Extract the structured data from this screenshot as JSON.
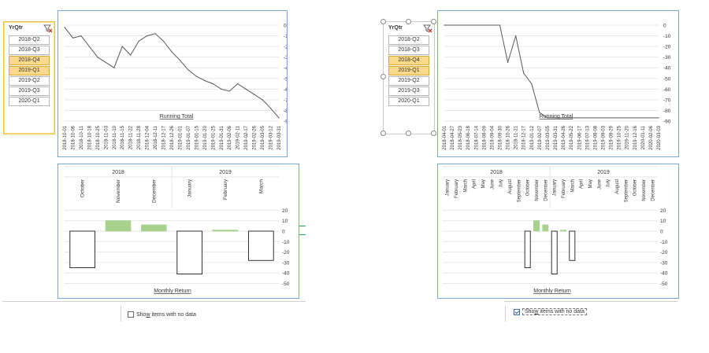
{
  "left": {
    "slicer": {
      "title": "YrQtr",
      "filter_icon": "clear-filter-icon",
      "items": [
        {
          "label": "2018-Q2",
          "selected": false
        },
        {
          "label": "2018-Q3",
          "selected": false
        },
        {
          "label": "2018-Q4",
          "selected": true
        },
        {
          "label": "2019-Q1",
          "selected": true
        },
        {
          "label": "2019-Q2",
          "selected": false
        },
        {
          "label": "2019-Q3",
          "selected": false
        },
        {
          "label": "2020-Q1",
          "selected": false
        }
      ]
    },
    "running_chart": {
      "title": "Running Total",
      "x_labels": [
        "2018-10-01",
        "2018-10-06",
        "2018-10-11",
        "2018-10-18",
        "2018-10-25",
        "2018-11-03",
        "2018-11-10",
        "2018-11-15",
        "2018-11-22",
        "2018-11-28",
        "2018-12-04",
        "2018-12-11",
        "2018-12-17",
        "2018-12-26",
        "2019-01-01",
        "2019-01-07",
        "2019-01-15",
        "2019-01-20",
        "2019-01-25",
        "2019-01-31",
        "2019-02-06",
        "2019-02-11",
        "2019-02-17",
        "2019-02-26",
        "2019-03-05",
        "2019-03-12",
        "2019-03-31"
      ],
      "y_ticks": [
        "0",
        "-10",
        "-20",
        "-30",
        "-40",
        "-50",
        "-60",
        "-70",
        "-80",
        "-90"
      ]
    },
    "monthly_chart": {
      "title": "Monthly Return",
      "years": [
        "2018",
        "2019"
      ],
      "months": [
        "October",
        "November",
        "December",
        "January",
        "February",
        "March"
      ],
      "y_ticks": [
        "20",
        "10",
        "0",
        "-10",
        "-20",
        "-30",
        "-40",
        "-50"
      ]
    },
    "show_items_label_pre": "Sho",
    "show_items_label_ul": "w",
    "show_items_label_post": " items with no data"
  },
  "right": {
    "slicer": {
      "title": "YrQtr",
      "filter_icon": "clear-filter-icon",
      "items": [
        {
          "label": "2018-Q2",
          "selected": false
        },
        {
          "label": "2018-Q3",
          "selected": false
        },
        {
          "label": "2018-Q4",
          "selected": true
        },
        {
          "label": "2019-Q1",
          "selected": true
        },
        {
          "label": "2019-Q2",
          "selected": false
        },
        {
          "label": "2019-Q3",
          "selected": false
        },
        {
          "label": "2020-Q1",
          "selected": false
        }
      ]
    },
    "running_chart": {
      "title": "Running Total",
      "x_labels": [
        "2018-04-01",
        "2018-04-27",
        "2018-05-23",
        "2018-06-18",
        "2018-07-14",
        "2018-08-09",
        "2018-09-04",
        "2018-09-30",
        "2018-10-26",
        "2018-11-21",
        "2018-12-17",
        "2019-01-12",
        "2019-02-07",
        "2019-03-05",
        "2019-03-31",
        "2019-04-26",
        "2019-05-22",
        "2019-06-17",
        "2019-07-13",
        "2019-08-08",
        "2019-09-03",
        "2019-09-29",
        "2019-10-25",
        "2019-11-20",
        "2019-12-16",
        "2020-01-11",
        "2020-02-06",
        "2020-03-03"
      ],
      "y_ticks": [
        "0",
        "-10",
        "-20",
        "-30",
        "-40",
        "-50",
        "-60",
        "-70",
        "-80",
        "-90"
      ]
    },
    "monthly_chart": {
      "title": "Monthly Return",
      "years": [
        "2018",
        "2019"
      ],
      "months_2018": [
        "January",
        "February",
        "March",
        "April",
        "May",
        "June",
        "July",
        "August",
        "September",
        "October",
        "November",
        "December"
      ],
      "months_2019": [
        "January",
        "February",
        "March",
        "April",
        "May",
        "June",
        "July",
        "August",
        "September",
        "October",
        "November",
        "December"
      ],
      "y_ticks": [
        "20",
        "10",
        "0",
        "-10",
        "-20",
        "-30",
        "-40",
        "-50"
      ]
    },
    "show_items_label_pre": "Sho",
    "show_items_label_ul": "w",
    "show_items_label_post": " items with no data"
  },
  "chart_data": [
    {
      "type": "line",
      "title": "Running Total",
      "ylim": [
        -90,
        0
      ],
      "x": [
        "2018-10-01",
        "2018-10-06",
        "2018-10-11",
        "2018-10-18",
        "2018-10-25",
        "2018-11-03",
        "2018-11-10",
        "2018-11-15",
        "2018-11-22",
        "2018-11-28",
        "2018-12-04",
        "2018-12-11",
        "2018-12-17",
        "2018-12-26",
        "2019-01-01",
        "2019-01-07",
        "2019-01-15",
        "2019-01-20",
        "2019-01-25",
        "2019-01-31",
        "2019-02-06",
        "2019-02-11",
        "2019-02-17",
        "2019-02-26",
        "2019-03-05",
        "2019-03-12",
        "2019-03-31"
      ],
      "values": [
        -2,
        -12,
        -10,
        -20,
        -30,
        -35,
        -40,
        -20,
        -28,
        -15,
        -10,
        -8,
        -15,
        -25,
        -33,
        -42,
        -48,
        -52,
        -55,
        -60,
        -62,
        -55,
        -60,
        -65,
        -70,
        -78,
        -87
      ]
    },
    {
      "type": "bar",
      "title": "Monthly Return",
      "ylim": [
        -50,
        20
      ],
      "categories": [
        "October",
        "November",
        "December",
        "January",
        "February",
        "March"
      ],
      "values": [
        -35,
        10,
        6,
        -41,
        1,
        -28
      ]
    },
    {
      "type": "line",
      "title": "Running Total",
      "ylim": [
        -90,
        0
      ],
      "x": [
        "2018-04-01",
        "2018-04-27",
        "2018-05-23",
        "2018-06-18",
        "2018-07-14",
        "2018-08-09",
        "2018-09-04",
        "2018-09-30",
        "2018-10-26",
        "2018-11-21",
        "2018-12-17",
        "2019-01-12",
        "2019-02-07",
        "2019-03-05",
        "2019-03-31",
        "2019-04-26",
        "2019-05-22",
        "2019-06-17",
        "2019-07-13",
        "2019-08-08",
        "2019-09-03",
        "2019-09-29",
        "2019-10-25",
        "2019-11-20",
        "2019-12-16",
        "2020-01-11",
        "2020-02-06",
        "2020-03-03"
      ],
      "values": [
        0,
        0,
        0,
        0,
        0,
        0,
        0,
        0,
        -35,
        -10,
        -45,
        -55,
        -82,
        -87,
        -87,
        -87,
        -87,
        -87,
        -87,
        -87,
        -87,
        -87,
        -87,
        -87,
        -87,
        -87,
        -87,
        -87
      ]
    },
    {
      "type": "bar",
      "title": "Monthly Return",
      "ylim": [
        -50,
        20
      ],
      "categories": [
        "January",
        "February",
        "March",
        "April",
        "May",
        "June",
        "July",
        "August",
        "September",
        "October",
        "November",
        "December",
        "January",
        "February",
        "March",
        "April",
        "May",
        "June",
        "July",
        "August",
        "September",
        "October",
        "November",
        "December"
      ],
      "values": [
        0,
        0,
        0,
        0,
        0,
        0,
        0,
        0,
        0,
        -35,
        10,
        6,
        -41,
        1,
        -28,
        0,
        0,
        0,
        0,
        0,
        0,
        0,
        0,
        0
      ]
    }
  ]
}
